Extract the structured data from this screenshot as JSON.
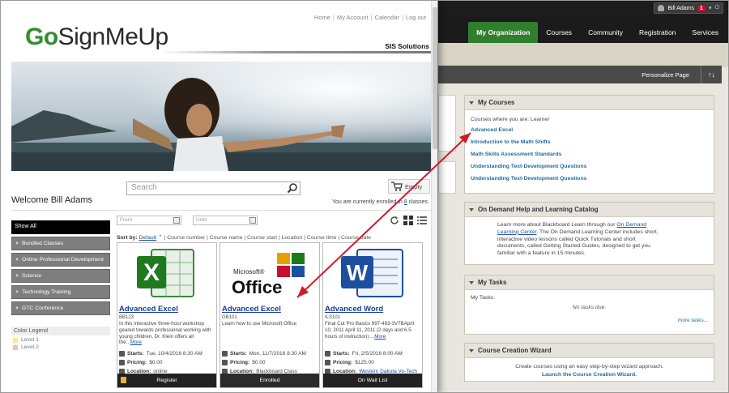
{
  "bb": {
    "user": {
      "name": "Bill Adams",
      "notifications": "1"
    },
    "nav_tabs": [
      "My Organization",
      "Courses",
      "Community",
      "Registration",
      "Services"
    ],
    "active_tab": "My Organization",
    "personalize_label": "Personalize Page",
    "sort_icon": "↑↓",
    "my_courses": {
      "title": "My Courses",
      "subtitle": "Courses where you are: Learner",
      "courses": [
        "Advanced Excel",
        "Introduction to the Math Shifts",
        "Math Skills Assessment Standards",
        "Understanding Text-Development Questions",
        "Understanding Text-Development Questions"
      ]
    },
    "on_demand": {
      "title": "On Demand Help and Learning Catalog",
      "text_before": "Learn more about Blackboard Learn through our ",
      "link": "On Demand Learning Center",
      "text_after": ". The On Demand Learning Center includes short, interactive video lessons called Quick Tutorials and short documents, called Getting Started Guides, designed to get you familiar with a feature in 15 minutes."
    },
    "my_tasks": {
      "title": "My Tasks",
      "label": "My Tasks:",
      "empty": "No tasks due.",
      "more": "more tasks..."
    },
    "wizard": {
      "title": "Course Creation Wizard",
      "text": "Create courses using an easy step-by-step wizard approach.",
      "link": "Launch the Course Creation Wizard."
    }
  },
  "gsmu": {
    "top_links": [
      "Home",
      "My Account",
      "Calendar",
      "Log out"
    ],
    "logo_go": "Go",
    "logo_rest": "SignMeUp",
    "sis": "SIS Solutions",
    "search_placeholder": "Search",
    "cart_label": "Empty",
    "welcome": "Welcome Bill Adams",
    "enrolled_prefix": "You are currently enrolled in ",
    "enrolled_count": "8",
    "enrolled_suffix": " classes",
    "sidebar": {
      "show_all": "Show All",
      "categories": [
        "Bundled Classes",
        "Online Professional Development",
        "Science",
        "Technology Training",
        "GTC Conference"
      ]
    },
    "legend": {
      "title": "Color Legend",
      "levels": [
        {
          "label": "Level 1",
          "color": "#f5f07a"
        },
        {
          "label": "Level 2",
          "color": "#f2b8d8"
        }
      ]
    },
    "from_placeholder": "From",
    "until_placeholder": "Until",
    "sort": {
      "label": "Sort by:",
      "default": "Default",
      "options": [
        "Course number",
        "Course name",
        "Course start",
        "Location",
        "Course time",
        "Course date"
      ]
    },
    "cards": [
      {
        "title": "Advanced Excel",
        "code": "BB123",
        "desc": "In this interactive three-hour workshop geared towards professional working with young children, Dr. Klein offers all the...",
        "more": "More",
        "starts_label": "Starts:",
        "starts": "Tue, 10/4/2016 8:30 AM",
        "pricing_label": "Pricing:",
        "pricing": "$0.00",
        "location_label": "Location:",
        "location": "online",
        "action": "Register"
      },
      {
        "title": "Advanced Excel",
        "code": "GB101",
        "desc": "Learn how to use Microsoft Office",
        "more": "",
        "starts_label": "Starts:",
        "starts": "Mon, 11/7/2016 8:30 AM",
        "pricing_label": "Pricing:",
        "pricing": "$0.00",
        "location_label": "Location:",
        "location": "Blackboard Class",
        "action": "Enrolled"
      },
      {
        "title": "Advanced Word",
        "code": "ILS101",
        "desc": "Final Cut Pro Basics 997-493-3V7BApril 10, 2011 April 11, 2011 (2 days and 6.5 hours of instruction) ...",
        "more": "More",
        "starts_label": "Starts:",
        "starts": "Fri, 2/5/2016 8:00 AM",
        "pricing_label": "Pricing:",
        "pricing": "$125.00",
        "location_label": "Location:",
        "location": "Western Dakota Vo-Tech",
        "action": "On Wait List"
      }
    ]
  }
}
